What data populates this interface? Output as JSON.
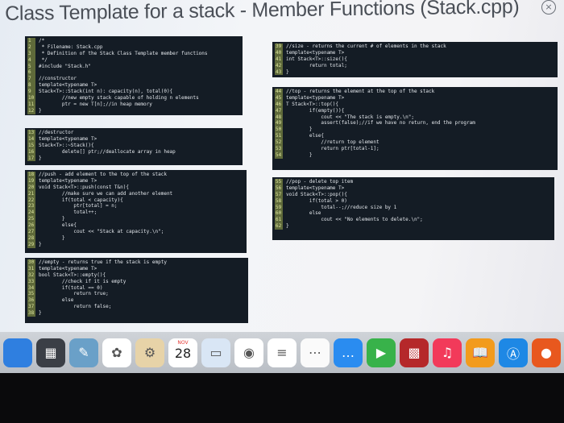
{
  "slide": {
    "title": "Class Template for a stack - Member Functions (Stack.cpp)"
  },
  "blocks": [
    {
      "id": "header",
      "lines": [
        [
          "1",
          "/*"
        ],
        [
          "2",
          " * Filename: Stack.cpp"
        ],
        [
          "3",
          " * Definition of the Stack Class Template member functions"
        ],
        [
          "4",
          " */"
        ],
        [
          "5",
          "#include \"Stack.h\""
        ],
        [
          "6",
          ""
        ],
        [
          "7",
          "//constructor"
        ],
        [
          "8",
          "template<typename T>"
        ],
        [
          "9",
          "Stack<T>::Stack(int n): capacity(n), total(0){"
        ],
        [
          "10",
          "        //new empty stack capable of holding n elements"
        ],
        [
          "11",
          "        ptr = new T[n];//in heap memory"
        ],
        [
          "12",
          "}"
        ]
      ]
    },
    {
      "id": "destructor",
      "lines": [
        [
          "13",
          "//destructor"
        ],
        [
          "14",
          "template<typename T>"
        ],
        [
          "15",
          "Stack<T>::~Stack(){"
        ],
        [
          "16",
          "        delete[] ptr;//deallocate array in heap"
        ],
        [
          "17",
          "}"
        ]
      ]
    },
    {
      "id": "push",
      "lines": [
        [
          "18",
          "//push - add element to the top of the stack"
        ],
        [
          "19",
          "template<typename T>"
        ],
        [
          "20",
          "void Stack<T>::push(const T&n){"
        ],
        [
          "21",
          "        //make sure we can add another element"
        ],
        [
          "22",
          "        if(total < capacity){"
        ],
        [
          "23",
          "            ptr[total] = n;"
        ],
        [
          "24",
          "            total++;"
        ],
        [
          "25",
          "        }"
        ],
        [
          "26",
          "        else{"
        ],
        [
          "27",
          "            cout << \"Stack at capacity.\\n\";"
        ],
        [
          "28",
          "        }"
        ],
        [
          "29",
          "}"
        ]
      ]
    },
    {
      "id": "empty",
      "lines": [
        [
          "30",
          "//empty - returns true if the stack is empty"
        ],
        [
          "31",
          "template<typename T>"
        ],
        [
          "32",
          "bool Stack<T>::empty(){"
        ],
        [
          "33",
          "        //check if it is empty"
        ],
        [
          "34",
          "        if(total == 0)"
        ],
        [
          "35",
          "            return true;"
        ],
        [
          "36",
          "        else"
        ],
        [
          "37",
          "            return false;"
        ],
        [
          "38",
          "}"
        ]
      ]
    },
    {
      "id": "size",
      "lines": [
        [
          "39",
          "//size - returns the current # of elements in the stack"
        ],
        [
          "40",
          "template<typename T>"
        ],
        [
          "41",
          "int Stack<T>::size(){"
        ],
        [
          "42",
          "        return total;"
        ],
        [
          "43",
          "}"
        ]
      ]
    },
    {
      "id": "top",
      "lines": [
        [
          "44",
          "//top - returns the element at the top of the stack"
        ],
        [
          "45",
          "template<typename T>"
        ],
        [
          "46",
          "T Stack<T>::top(){"
        ],
        [
          "47",
          "        if(empty()){"
        ],
        [
          "48",
          "            cout << \"The stack is empty.\\n\";"
        ],
        [
          "49",
          "            assert(false);//if we have no return, end the program"
        ],
        [
          "50",
          "        }"
        ],
        [
          "51",
          "        else{"
        ],
        [
          "52",
          "            //return top element"
        ],
        [
          "53",
          "            return ptr[total-1];"
        ],
        [
          "54",
          "        }"
        ]
      ]
    },
    {
      "id": "pop",
      "lines": [
        [
          "55",
          "//pop - delete top item"
        ],
        [
          "56",
          "template<typename T>"
        ],
        [
          "57",
          "void Stack<T>::pop(){"
        ],
        [
          "58",
          "        if(total > 0)"
        ],
        [
          "59",
          "            total--;//reduce size by 1"
        ],
        [
          "60",
          "        else"
        ],
        [
          "61",
          "            cout << \"No elements to delete.\\n\";"
        ],
        [
          "62",
          "}"
        ]
      ]
    }
  ],
  "dock": {
    "calendar_month": "NOV",
    "calendar_day": "28",
    "apps": [
      {
        "name": "finder-icon",
        "color": "#2f7fe0",
        "glyph": ""
      },
      {
        "name": "launchpad-icon",
        "color": "#3b3f46",
        "glyph": "▦"
      },
      {
        "name": "preview-icon",
        "color": "#6aa0c8",
        "glyph": "✎"
      },
      {
        "name": "photos-icon",
        "color": "#ffffff",
        "glyph": "✿"
      },
      {
        "name": "app-store-alt-icon",
        "color": "#e7d3a8",
        "glyph": "⚙"
      },
      {
        "name": "calendar-icon",
        "color": "#ffffff",
        "glyph": ""
      },
      {
        "name": "keynote-icon",
        "color": "#d9e6f5",
        "glyph": "▭"
      },
      {
        "name": "chrome-icon",
        "color": "#ffffff",
        "glyph": "◉"
      },
      {
        "name": "notes-icon",
        "color": "#ffffff",
        "glyph": "≡"
      },
      {
        "name": "reminders-icon",
        "color": "#fafafa",
        "glyph": "⋯"
      },
      {
        "name": "messages-icon",
        "color": "#2a8cf0",
        "glyph": "…"
      },
      {
        "name": "facetime-icon",
        "color": "#38b24a",
        "glyph": "▶"
      },
      {
        "name": "photo-booth-icon",
        "color": "#b5282a",
        "glyph": "▩"
      },
      {
        "name": "music-icon",
        "color": "#f23a5a",
        "glyph": "♫"
      },
      {
        "name": "books-icon",
        "color": "#f29b1d",
        "glyph": "📖"
      },
      {
        "name": "app-store-icon",
        "color": "#1e88e5",
        "glyph": "Ⓐ"
      },
      {
        "name": "firefox-icon",
        "color": "#e8581e",
        "glyph": "●"
      }
    ]
  }
}
